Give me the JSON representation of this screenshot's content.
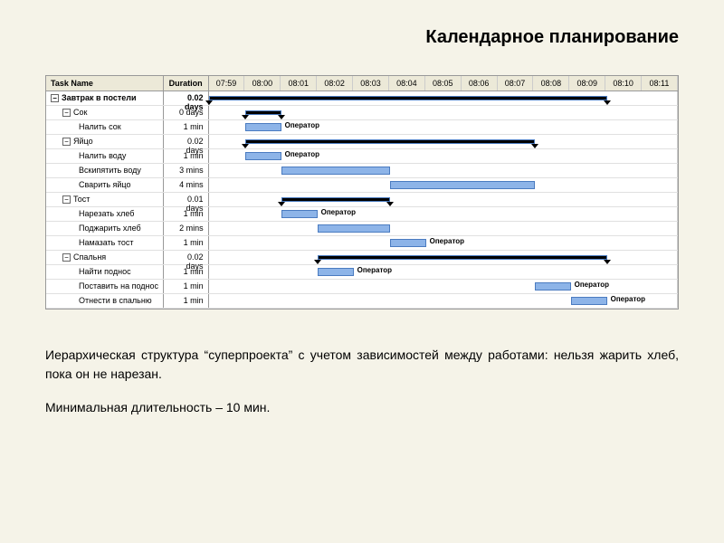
{
  "title": "Календарное планирование",
  "columns": {
    "task": "Task Name",
    "duration": "Duration"
  },
  "timeline": [
    "07:59",
    "08:00",
    "08:01",
    "08:02",
    "08:03",
    "08:04",
    "08:05",
    "08:06",
    "08:07",
    "08:08",
    "08:09",
    "08:10",
    "08:11"
  ],
  "operator_label": "Оператор",
  "tasks": [
    {
      "name": "Завтрак в постели",
      "dur": "0.02 days",
      "lvl": 0,
      "type": "summary",
      "start": 0,
      "end": 11
    },
    {
      "name": "Сок",
      "dur": "0 days",
      "lvl": 1,
      "type": "summary",
      "start": 1,
      "end": 2
    },
    {
      "name": "Налить сок",
      "dur": "1 min",
      "lvl": 2,
      "type": "task",
      "start": 1,
      "end": 2,
      "label": "Оператор"
    },
    {
      "name": "Яйцо",
      "dur": "0.02 days",
      "lvl": 1,
      "type": "summary",
      "start": 1,
      "end": 9
    },
    {
      "name": "Налить воду",
      "dur": "1 min",
      "lvl": 2,
      "type": "task",
      "start": 1,
      "end": 2,
      "label": "Оператор"
    },
    {
      "name": "Вскипятить воду",
      "dur": "3 mins",
      "lvl": 2,
      "type": "task",
      "start": 2,
      "end": 5
    },
    {
      "name": "Сварить яйцо",
      "dur": "4 mins",
      "lvl": 2,
      "type": "task",
      "start": 5,
      "end": 9
    },
    {
      "name": "Тост",
      "dur": "0.01 days",
      "lvl": 1,
      "type": "summary",
      "start": 2,
      "end": 5
    },
    {
      "name": "Нарезать хлеб",
      "dur": "1 min",
      "lvl": 2,
      "type": "task",
      "start": 2,
      "end": 3,
      "label": "Оператор"
    },
    {
      "name": "Поджарить хлеб",
      "dur": "2 mins",
      "lvl": 2,
      "type": "task",
      "start": 3,
      "end": 5
    },
    {
      "name": "Намазать тост",
      "dur": "1 min",
      "lvl": 2,
      "type": "task",
      "start": 5,
      "end": 6,
      "label": "Оператор"
    },
    {
      "name": "Спальня",
      "dur": "0.02 days",
      "lvl": 1,
      "type": "summary",
      "start": 3,
      "end": 11
    },
    {
      "name": "Найти поднос",
      "dur": "1 min",
      "lvl": 2,
      "type": "task",
      "start": 3,
      "end": 4,
      "label": "Оператор"
    },
    {
      "name": "Поставить на поднос",
      "dur": "1 min",
      "lvl": 2,
      "type": "task",
      "start": 9,
      "end": 10,
      "label": "Оператор"
    },
    {
      "name": "Отнести в спальню",
      "dur": "1 min",
      "lvl": 2,
      "type": "task",
      "start": 10,
      "end": 11,
      "label": "Оператор"
    }
  ],
  "caption": "Иерархическая структура “суперпроекта” с учетом зависимостей между работами: нельзя жарить хлеб, пока он не нарезан.",
  "caption2": "Минимальная длительность – 10 мин.",
  "chart_data": {
    "type": "gantt",
    "title": "Календарное планирование",
    "time_axis": {
      "start": "07:59",
      "end": "08:11",
      "unit": "min",
      "ticks": [
        "07:59",
        "08:00",
        "08:01",
        "08:02",
        "08:03",
        "08:04",
        "08:05",
        "08:06",
        "08:07",
        "08:08",
        "08:09",
        "08:10",
        "08:11"
      ]
    },
    "resource_label": "Оператор",
    "tasks": [
      {
        "id": 1,
        "name": "Завтрак в постели",
        "duration": "0.02 days",
        "level": 0,
        "summary": true,
        "start_min": 0,
        "end_min": 11
      },
      {
        "id": 2,
        "name": "Сок",
        "duration": "0 days",
        "level": 1,
        "summary": true,
        "start_min": 1,
        "end_min": 2
      },
      {
        "id": 3,
        "name": "Налить сок",
        "duration": "1 min",
        "level": 2,
        "summary": false,
        "start_min": 1,
        "end_min": 2,
        "resource": "Оператор"
      },
      {
        "id": 4,
        "name": "Яйцо",
        "duration": "0.02 days",
        "level": 1,
        "summary": true,
        "start_min": 1,
        "end_min": 9
      },
      {
        "id": 5,
        "name": "Налить воду",
        "duration": "1 min",
        "level": 2,
        "summary": false,
        "start_min": 1,
        "end_min": 2,
        "resource": "Оператор"
      },
      {
        "id": 6,
        "name": "Вскипятить воду",
        "duration": "3 mins",
        "level": 2,
        "summary": false,
        "start_min": 2,
        "end_min": 5
      },
      {
        "id": 7,
        "name": "Сварить яйцо",
        "duration": "4 mins",
        "level": 2,
        "summary": false,
        "start_min": 5,
        "end_min": 9
      },
      {
        "id": 8,
        "name": "Тост",
        "duration": "0.01 days",
        "level": 1,
        "summary": true,
        "start_min": 2,
        "end_min": 5
      },
      {
        "id": 9,
        "name": "Нарезать хлеб",
        "duration": "1 min",
        "level": 2,
        "summary": false,
        "start_min": 2,
        "end_min": 3,
        "resource": "Оператор"
      },
      {
        "id": 10,
        "name": "Поджарить хлеб",
        "duration": "2 mins",
        "level": 2,
        "summary": false,
        "start_min": 3,
        "end_min": 5
      },
      {
        "id": 11,
        "name": "Намазать тост",
        "duration": "1 min",
        "level": 2,
        "summary": false,
        "start_min": 5,
        "end_min": 6,
        "resource": "Оператор"
      },
      {
        "id": 12,
        "name": "Спальня",
        "duration": "0.02 days",
        "level": 1,
        "summary": true,
        "start_min": 3,
        "end_min": 11
      },
      {
        "id": 13,
        "name": "Найти поднос",
        "duration": "1 min",
        "level": 2,
        "summary": false,
        "start_min": 3,
        "end_min": 4,
        "resource": "Оператор"
      },
      {
        "id": 14,
        "name": "Поставить на поднос",
        "duration": "1 min",
        "level": 2,
        "summary": false,
        "start_min": 9,
        "end_min": 10,
        "resource": "Оператор"
      },
      {
        "id": 15,
        "name": "Отнести в спальню",
        "duration": "1 min",
        "level": 2,
        "summary": false,
        "start_min": 10,
        "end_min": 11,
        "resource": "Оператор"
      }
    ],
    "min_duration_minutes": 10
  }
}
